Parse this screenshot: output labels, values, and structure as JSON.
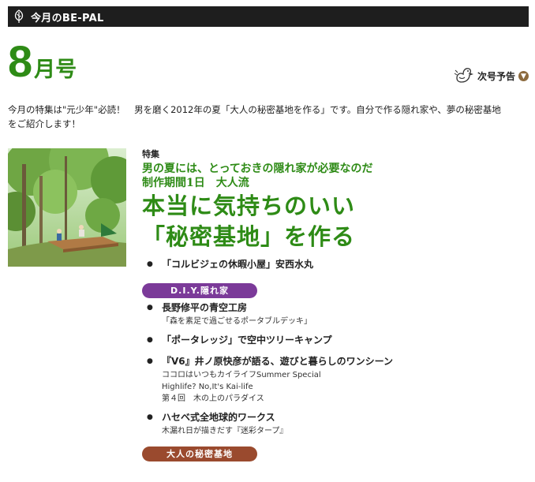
{
  "header": {
    "title": "今月のBE-PAL",
    "icon": "leaf-icon"
  },
  "issue": {
    "number": "8",
    "suffix": "月号"
  },
  "next_issue": {
    "label": "次号予告",
    "icon": "bird-icon",
    "arrow_icon": "chevron-down-icon"
  },
  "intro": {
    "line1": "今月の特集は\"元少年\"必読！　男を磨く2012年の夏「大人の秘密基地を作る」です。自分で作る隠れ家や、夢の秘密基地",
    "line2": "をご紹介します！"
  },
  "feature": {
    "label": "特集",
    "subtitle1": "男の夏には、とっておきの隠れ家が必要なのだ",
    "subtitle2": "制作期間1日　大人流",
    "headline1": "本当に気持ちのいい",
    "headline2": "「秘密基地」を作る"
  },
  "items": {
    "item1": "「コルビジェの休暇小屋」安西水丸",
    "section1": "D.I.Y.隠れ家",
    "item2": "長野修平の青空工房",
    "item2_note": "「森を素足で過ごせるポータブルデッキ」",
    "item3": "「ポータレッジ」で空中ツリーキャンプ",
    "item4": "『V6』井ノ原快彦が語る、遊びと暮らしのワンシーン",
    "item4_note1": "ココロはいつもカイライフSummer Special",
    "item4_note2": "Highlife? No,It's Kai-life",
    "item4_note3": "第４回　木の上のパラダイス",
    "item5": "ハセベ式全地球的ワークス",
    "item5_note": "木漏れ日が描きだす『迷彩タープ』",
    "section2": "大人の秘密基地"
  },
  "colors": {
    "header_bg": "#1e1e1e",
    "accent_green": "#2e8b16",
    "pill_purple": "#7b3a99",
    "pill_brown": "#9a4a2e",
    "arrow_brown": "#8c6a3e"
  }
}
